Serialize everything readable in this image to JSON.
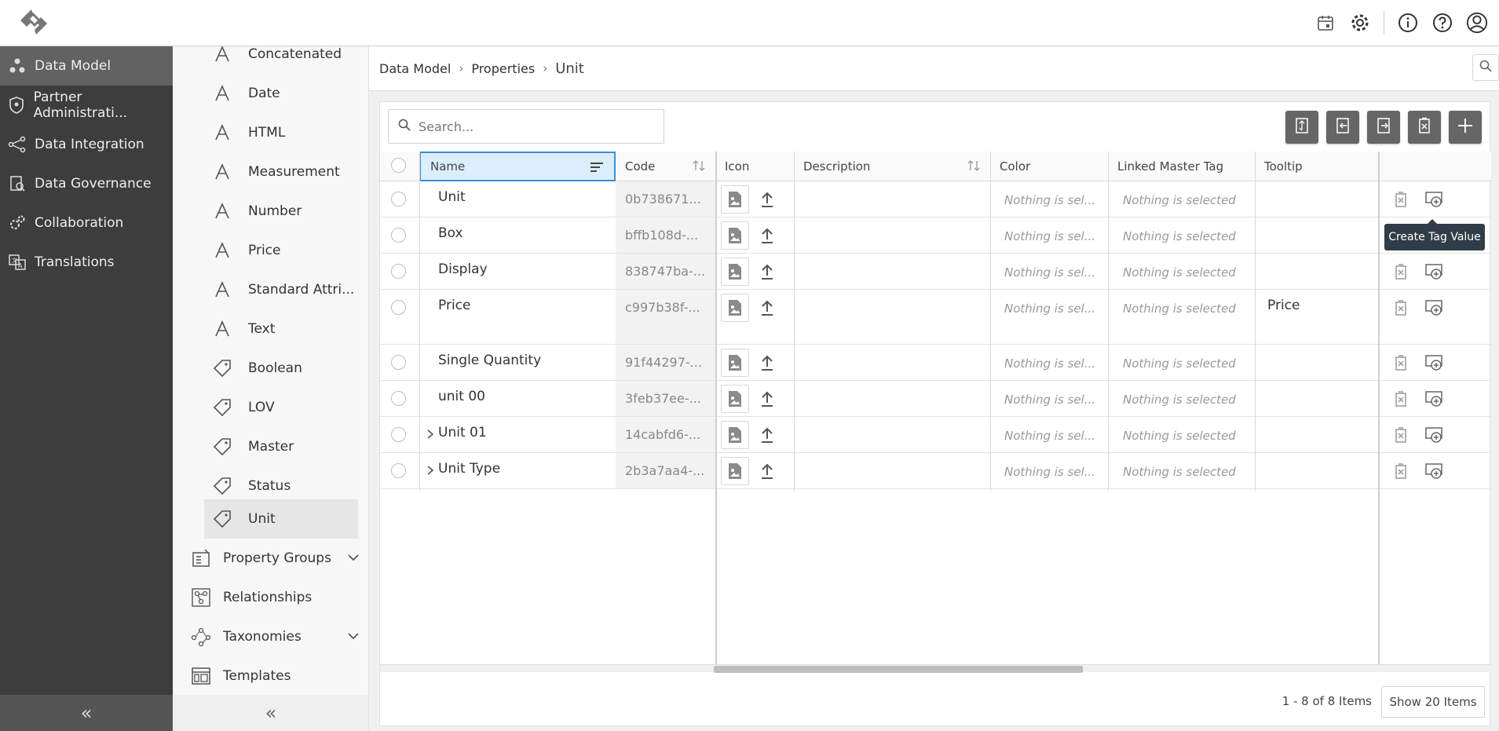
{
  "nav": {
    "items": [
      {
        "label": "Data Model",
        "icon": "data-model-icon",
        "active": true
      },
      {
        "label": "Partner Administrati...",
        "icon": "shield-icon"
      },
      {
        "label": "Data Integration",
        "icon": "integration-icon"
      },
      {
        "label": "Data Governance",
        "icon": "governance-icon"
      },
      {
        "label": "Collaboration",
        "icon": "gears-icon"
      },
      {
        "label": "Translations",
        "icon": "translate-icon"
      }
    ],
    "collapse_label": "«"
  },
  "tree": {
    "items": [
      {
        "label": "Concatenated",
        "icon": "attribute-icon"
      },
      {
        "label": "Date",
        "icon": "attribute-icon"
      },
      {
        "label": "HTML",
        "icon": "attribute-icon"
      },
      {
        "label": "Measurement",
        "icon": "attribute-icon"
      },
      {
        "label": "Number",
        "icon": "attribute-icon"
      },
      {
        "label": "Price",
        "icon": "attribute-icon"
      },
      {
        "label": "Standard Attri...",
        "icon": "attribute-icon"
      },
      {
        "label": "Text",
        "icon": "attribute-icon"
      },
      {
        "label": "Boolean",
        "icon": "tag-icon"
      },
      {
        "label": "LOV",
        "icon": "tag-icon"
      },
      {
        "label": "Master",
        "icon": "tag-icon"
      },
      {
        "label": "Status",
        "icon": "tag-icon"
      },
      {
        "label": "Unit",
        "icon": "tag-icon",
        "active": true
      }
    ],
    "groups": [
      {
        "label": "Property Groups",
        "icon": "property-groups-icon",
        "expandable": true
      },
      {
        "label": "Relationships",
        "icon": "relationships-icon",
        "expandable": false
      },
      {
        "label": "Taxonomies",
        "icon": "taxonomies-icon",
        "expandable": true
      },
      {
        "label": "Templates",
        "icon": "templates-icon",
        "expandable": false
      }
    ],
    "collapse_label": "«"
  },
  "breadcrumb": {
    "items": [
      "Data Model",
      "Properties"
    ],
    "current": "Unit",
    "separator": "›"
  },
  "search": {
    "placeholder": "Search...",
    "value": ""
  },
  "table": {
    "columns": {
      "name": "Name",
      "code": "Code",
      "icon": "Icon",
      "description": "Description",
      "color": "Color",
      "linked_master_tag": "Linked Master Tag",
      "tooltip": "Tooltip"
    },
    "rows": [
      {
        "name": "Unit",
        "code": "0b738671...",
        "color": "Nothing is sel...",
        "linked": "Nothing is selected",
        "tooltip": "",
        "expandable": false
      },
      {
        "name": "Box",
        "code": "bffb108d-...",
        "color": "Nothing is sel...",
        "linked": "Nothing is selected",
        "tooltip": "",
        "expandable": false
      },
      {
        "name": "Display",
        "code": "838747ba-...",
        "color": "Nothing is sel...",
        "linked": "Nothing is selected",
        "tooltip": "",
        "expandable": false
      },
      {
        "name": "Price",
        "code": "c997b38f-...",
        "color": "Nothing is sel...",
        "linked": "Nothing is selected",
        "tooltip": "Price",
        "expandable": false,
        "tall": true
      },
      {
        "name": "Single Quantity",
        "code": "91f44297-...",
        "color": "Nothing is sel...",
        "linked": "Nothing is selected",
        "tooltip": "",
        "expandable": false
      },
      {
        "name": "unit 00",
        "code": "3feb37ee-...",
        "color": "Nothing is sel...",
        "linked": "Nothing is selected",
        "tooltip": "",
        "expandable": false
      },
      {
        "name": "Unit 01",
        "code": "14cabfd6-...",
        "color": "Nothing is sel...",
        "linked": "Nothing is selected",
        "tooltip": "",
        "expandable": true
      },
      {
        "name": "Unit Type",
        "code": "2b3a7aa4-...",
        "color": "Nothing is sel...",
        "linked": "Nothing is selected",
        "tooltip": "",
        "expandable": true
      }
    ]
  },
  "tooltip_popup": "Create Tag Value",
  "footer": {
    "count": "1 - 8 of 8 Items",
    "page_size": "Show 20 Items"
  },
  "colors": {
    "nav_bg": "#3d3d3d",
    "nav_active": "#626262",
    "selected_header": "#dbeefc",
    "accent": "#3a8fd6",
    "toolbar_btn": "#666666"
  }
}
